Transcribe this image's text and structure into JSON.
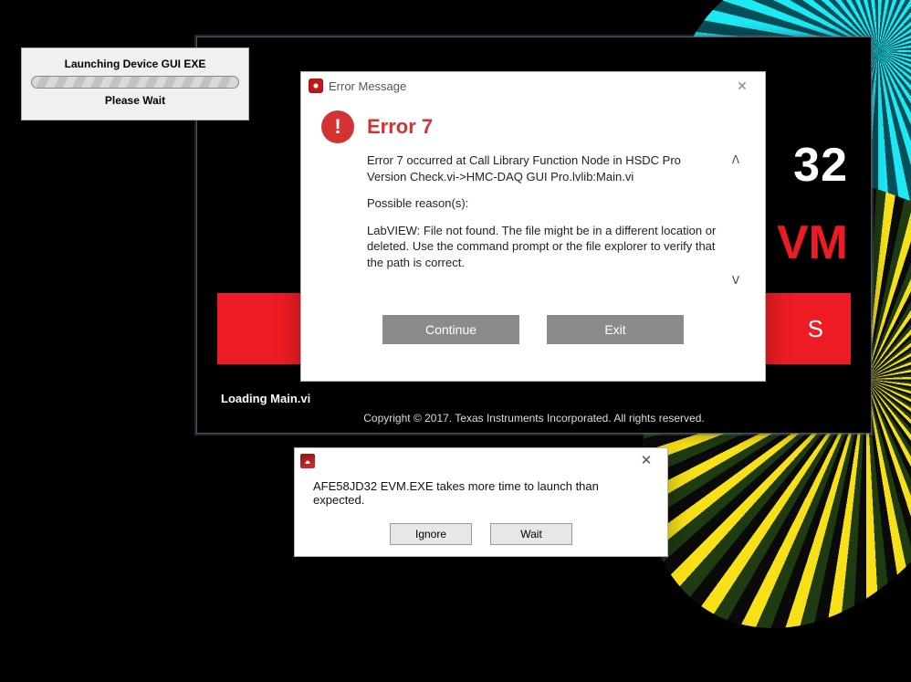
{
  "launch_box": {
    "line1": "Launching Device GUI EXE",
    "line2": "Please Wait"
  },
  "splash": {
    "title_suffix": "32",
    "subtitle_suffix": "VM",
    "banner_suffix": "S",
    "loading": "Loading Main.vi",
    "copyright": "Copyright © 2017. Texas Instruments Incorporated. All rights reserved."
  },
  "error_dialog": {
    "window_title": "Error Message",
    "heading": "Error 7",
    "para1": "Error 7 occurred at Call Library Function Node in HSDC Pro Version Check.vi->HMC-DAQ GUI Pro.lvlib:Main.vi",
    "para2": "Possible reason(s):",
    "para3": "LabVIEW:  File not found. The file might be in a different location or deleted. Use the command prompt or the file explorer to verify that the path is correct.",
    "continue": "Continue",
    "exit": "Exit"
  },
  "timeout_dialog": {
    "message": "AFE58JD32 EVM.EXE takes more time to launch than expected.",
    "ignore": "Ignore",
    "wait": "Wait"
  }
}
